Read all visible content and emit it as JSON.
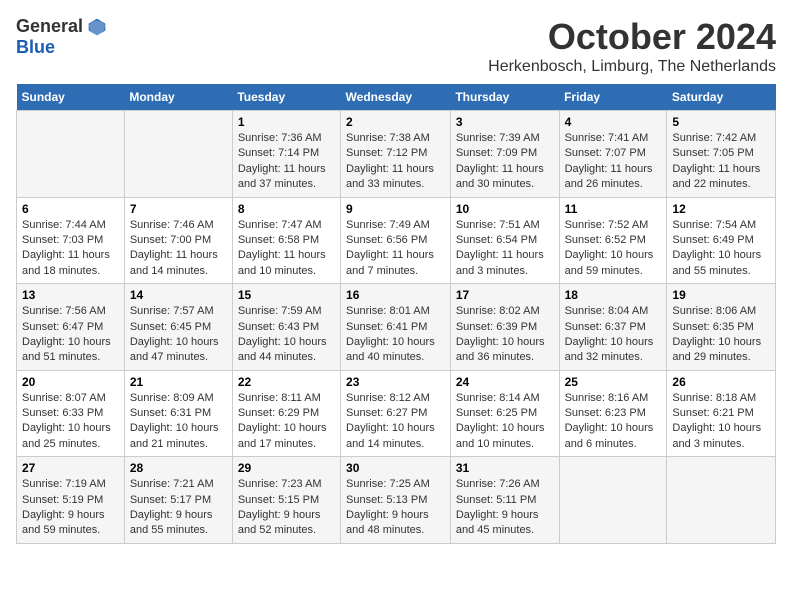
{
  "logo": {
    "general": "General",
    "blue": "Blue"
  },
  "title": "October 2024",
  "location": "Herkenbosch, Limburg, The Netherlands",
  "headers": [
    "Sunday",
    "Monday",
    "Tuesday",
    "Wednesday",
    "Thursday",
    "Friday",
    "Saturday"
  ],
  "weeks": [
    [
      {
        "day": "",
        "info": ""
      },
      {
        "day": "",
        "info": ""
      },
      {
        "day": "1",
        "info": "Sunrise: 7:36 AM\nSunset: 7:14 PM\nDaylight: 11 hours and 37 minutes."
      },
      {
        "day": "2",
        "info": "Sunrise: 7:38 AM\nSunset: 7:12 PM\nDaylight: 11 hours and 33 minutes."
      },
      {
        "day": "3",
        "info": "Sunrise: 7:39 AM\nSunset: 7:09 PM\nDaylight: 11 hours and 30 minutes."
      },
      {
        "day": "4",
        "info": "Sunrise: 7:41 AM\nSunset: 7:07 PM\nDaylight: 11 hours and 26 minutes."
      },
      {
        "day": "5",
        "info": "Sunrise: 7:42 AM\nSunset: 7:05 PM\nDaylight: 11 hours and 22 minutes."
      }
    ],
    [
      {
        "day": "6",
        "info": "Sunrise: 7:44 AM\nSunset: 7:03 PM\nDaylight: 11 hours and 18 minutes."
      },
      {
        "day": "7",
        "info": "Sunrise: 7:46 AM\nSunset: 7:00 PM\nDaylight: 11 hours and 14 minutes."
      },
      {
        "day": "8",
        "info": "Sunrise: 7:47 AM\nSunset: 6:58 PM\nDaylight: 11 hours and 10 minutes."
      },
      {
        "day": "9",
        "info": "Sunrise: 7:49 AM\nSunset: 6:56 PM\nDaylight: 11 hours and 7 minutes."
      },
      {
        "day": "10",
        "info": "Sunrise: 7:51 AM\nSunset: 6:54 PM\nDaylight: 11 hours and 3 minutes."
      },
      {
        "day": "11",
        "info": "Sunrise: 7:52 AM\nSunset: 6:52 PM\nDaylight: 10 hours and 59 minutes."
      },
      {
        "day": "12",
        "info": "Sunrise: 7:54 AM\nSunset: 6:49 PM\nDaylight: 10 hours and 55 minutes."
      }
    ],
    [
      {
        "day": "13",
        "info": "Sunrise: 7:56 AM\nSunset: 6:47 PM\nDaylight: 10 hours and 51 minutes."
      },
      {
        "day": "14",
        "info": "Sunrise: 7:57 AM\nSunset: 6:45 PM\nDaylight: 10 hours and 47 minutes."
      },
      {
        "day": "15",
        "info": "Sunrise: 7:59 AM\nSunset: 6:43 PM\nDaylight: 10 hours and 44 minutes."
      },
      {
        "day": "16",
        "info": "Sunrise: 8:01 AM\nSunset: 6:41 PM\nDaylight: 10 hours and 40 minutes."
      },
      {
        "day": "17",
        "info": "Sunrise: 8:02 AM\nSunset: 6:39 PM\nDaylight: 10 hours and 36 minutes."
      },
      {
        "day": "18",
        "info": "Sunrise: 8:04 AM\nSunset: 6:37 PM\nDaylight: 10 hours and 32 minutes."
      },
      {
        "day": "19",
        "info": "Sunrise: 8:06 AM\nSunset: 6:35 PM\nDaylight: 10 hours and 29 minutes."
      }
    ],
    [
      {
        "day": "20",
        "info": "Sunrise: 8:07 AM\nSunset: 6:33 PM\nDaylight: 10 hours and 25 minutes."
      },
      {
        "day": "21",
        "info": "Sunrise: 8:09 AM\nSunset: 6:31 PM\nDaylight: 10 hours and 21 minutes."
      },
      {
        "day": "22",
        "info": "Sunrise: 8:11 AM\nSunset: 6:29 PM\nDaylight: 10 hours and 17 minutes."
      },
      {
        "day": "23",
        "info": "Sunrise: 8:12 AM\nSunset: 6:27 PM\nDaylight: 10 hours and 14 minutes."
      },
      {
        "day": "24",
        "info": "Sunrise: 8:14 AM\nSunset: 6:25 PM\nDaylight: 10 hours and 10 minutes."
      },
      {
        "day": "25",
        "info": "Sunrise: 8:16 AM\nSunset: 6:23 PM\nDaylight: 10 hours and 6 minutes."
      },
      {
        "day": "26",
        "info": "Sunrise: 8:18 AM\nSunset: 6:21 PM\nDaylight: 10 hours and 3 minutes."
      }
    ],
    [
      {
        "day": "27",
        "info": "Sunrise: 7:19 AM\nSunset: 5:19 PM\nDaylight: 9 hours and 59 minutes."
      },
      {
        "day": "28",
        "info": "Sunrise: 7:21 AM\nSunset: 5:17 PM\nDaylight: 9 hours and 55 minutes."
      },
      {
        "day": "29",
        "info": "Sunrise: 7:23 AM\nSunset: 5:15 PM\nDaylight: 9 hours and 52 minutes."
      },
      {
        "day": "30",
        "info": "Sunrise: 7:25 AM\nSunset: 5:13 PM\nDaylight: 9 hours and 48 minutes."
      },
      {
        "day": "31",
        "info": "Sunrise: 7:26 AM\nSunset: 5:11 PM\nDaylight: 9 hours and 45 minutes."
      },
      {
        "day": "",
        "info": ""
      },
      {
        "day": "",
        "info": ""
      }
    ]
  ]
}
